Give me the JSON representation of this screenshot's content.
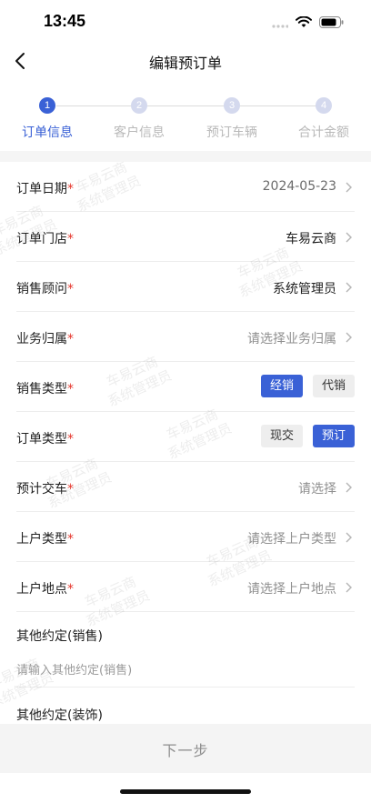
{
  "status_bar": {
    "time": "13:45"
  },
  "nav": {
    "title": "编辑预订单"
  },
  "steps": [
    {
      "num": "1",
      "label": "订单信息",
      "state": "active"
    },
    {
      "num": "2",
      "label": "客户信息",
      "state": "inactive"
    },
    {
      "num": "3",
      "label": "预订车辆",
      "state": "inactive"
    },
    {
      "num": "4",
      "label": "合计金额",
      "state": "inactive"
    }
  ],
  "form": {
    "order_date": {
      "label": "订单日期",
      "required": "*",
      "value": "2024-05-23"
    },
    "order_store": {
      "label": "订单门店",
      "required": "*",
      "value": "车易云商"
    },
    "sales_consultant": {
      "label": "销售顾问",
      "required": "*",
      "value": "系统管理员"
    },
    "business_owner": {
      "label": "业务归属",
      "required": "*",
      "placeholder": "请选择业务归属"
    },
    "sales_type": {
      "label": "销售类型",
      "required": "*",
      "options": [
        "经销",
        "代销"
      ],
      "selected": "经销"
    },
    "order_type": {
      "label": "订单类型",
      "required": "*",
      "options": [
        "现交",
        "预订"
      ],
      "selected": "预订"
    },
    "expected_delivery": {
      "label": "预计交车",
      "required": "*",
      "placeholder": "请选择"
    },
    "registration_type": {
      "label": "上户类型",
      "required": "*",
      "placeholder": "请选择上户类型"
    },
    "registration_location": {
      "label": "上户地点",
      "required": "*",
      "placeholder": "请选择上户地点"
    },
    "other_sales": {
      "label": "其他约定(销售)",
      "placeholder": "请输入其他约定(销售)"
    },
    "other_decoration": {
      "label": "其他约定(装饰)"
    }
  },
  "footer": {
    "next_label": "下一步"
  },
  "watermark": {
    "line1": "车易云商",
    "line2": "系统管理员"
  },
  "colors": {
    "accent": "#3a61d6",
    "required": "#e5352b"
  }
}
